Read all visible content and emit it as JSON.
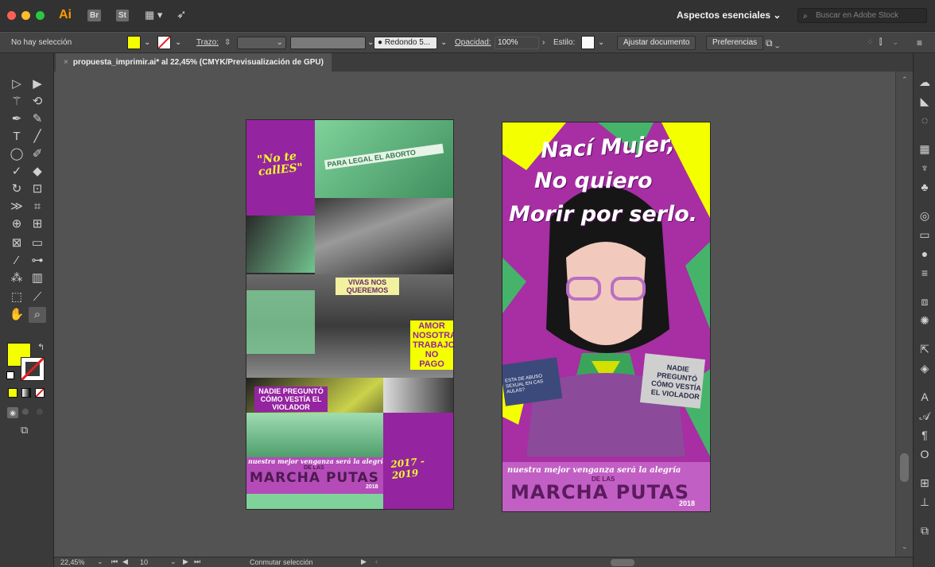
{
  "app": {
    "badge": "Ai",
    "bridge": "Br",
    "stock_app": "St",
    "workspace": "Aspectos esenciales",
    "search_placeholder": "Buscar en Adobe Stock"
  },
  "control": {
    "selection": "No hay selección",
    "stroke_label": "Trazo:",
    "brush": "Redondo 5...",
    "opacity_label": "Opacidad:",
    "opacity_value": "100%",
    "style_label": "Estilo:",
    "fit_button": "Ajustar documento",
    "prefs_button": "Preferencias",
    "fill_color": "#f4ff00"
  },
  "tab": {
    "close": "×",
    "title": "propuesta_imprimir.ai* al 22,45% (CMYK/Previsualización de GPU)"
  },
  "status": {
    "zoom": "22,45%",
    "page": "10",
    "mode": "Conmutar selección"
  },
  "artboard1": {
    "quote": "\"No te callES\"",
    "years": "2017 - 2019",
    "sign1": "PARA LEGAL EL ABORTO",
    "sign2": "VIVAS NOS QUEREMOS",
    "sign3": "AMOR NOSOTRAS TRABAJO NO PAGO",
    "sign4": "NADIE PREGUNTÓ CÓMO VESTÍA EL VIOLADOR",
    "banner_line": "nuestra mejor venganza será la alegría",
    "banner_big": "MARCHA PUTAS",
    "banner_small": "DE LAS",
    "banner_year": "2018"
  },
  "artboard2": {
    "line1": "Nací Mujer,",
    "line2": "No quiero",
    "line3": "Morir por serlo.",
    "sign_left": "ESTA DE ABUSO SEXUAL EN CAS AULAS?",
    "sign_right": "NADIE PREGUNTÓ CÓMO VESTÍA EL VIOLADOR",
    "banner_line": "nuestra mejor venganza será la alegría",
    "banner_big": "MARCHA PUTAS",
    "banner_small": "DE LAS",
    "banner_year": "2018"
  }
}
